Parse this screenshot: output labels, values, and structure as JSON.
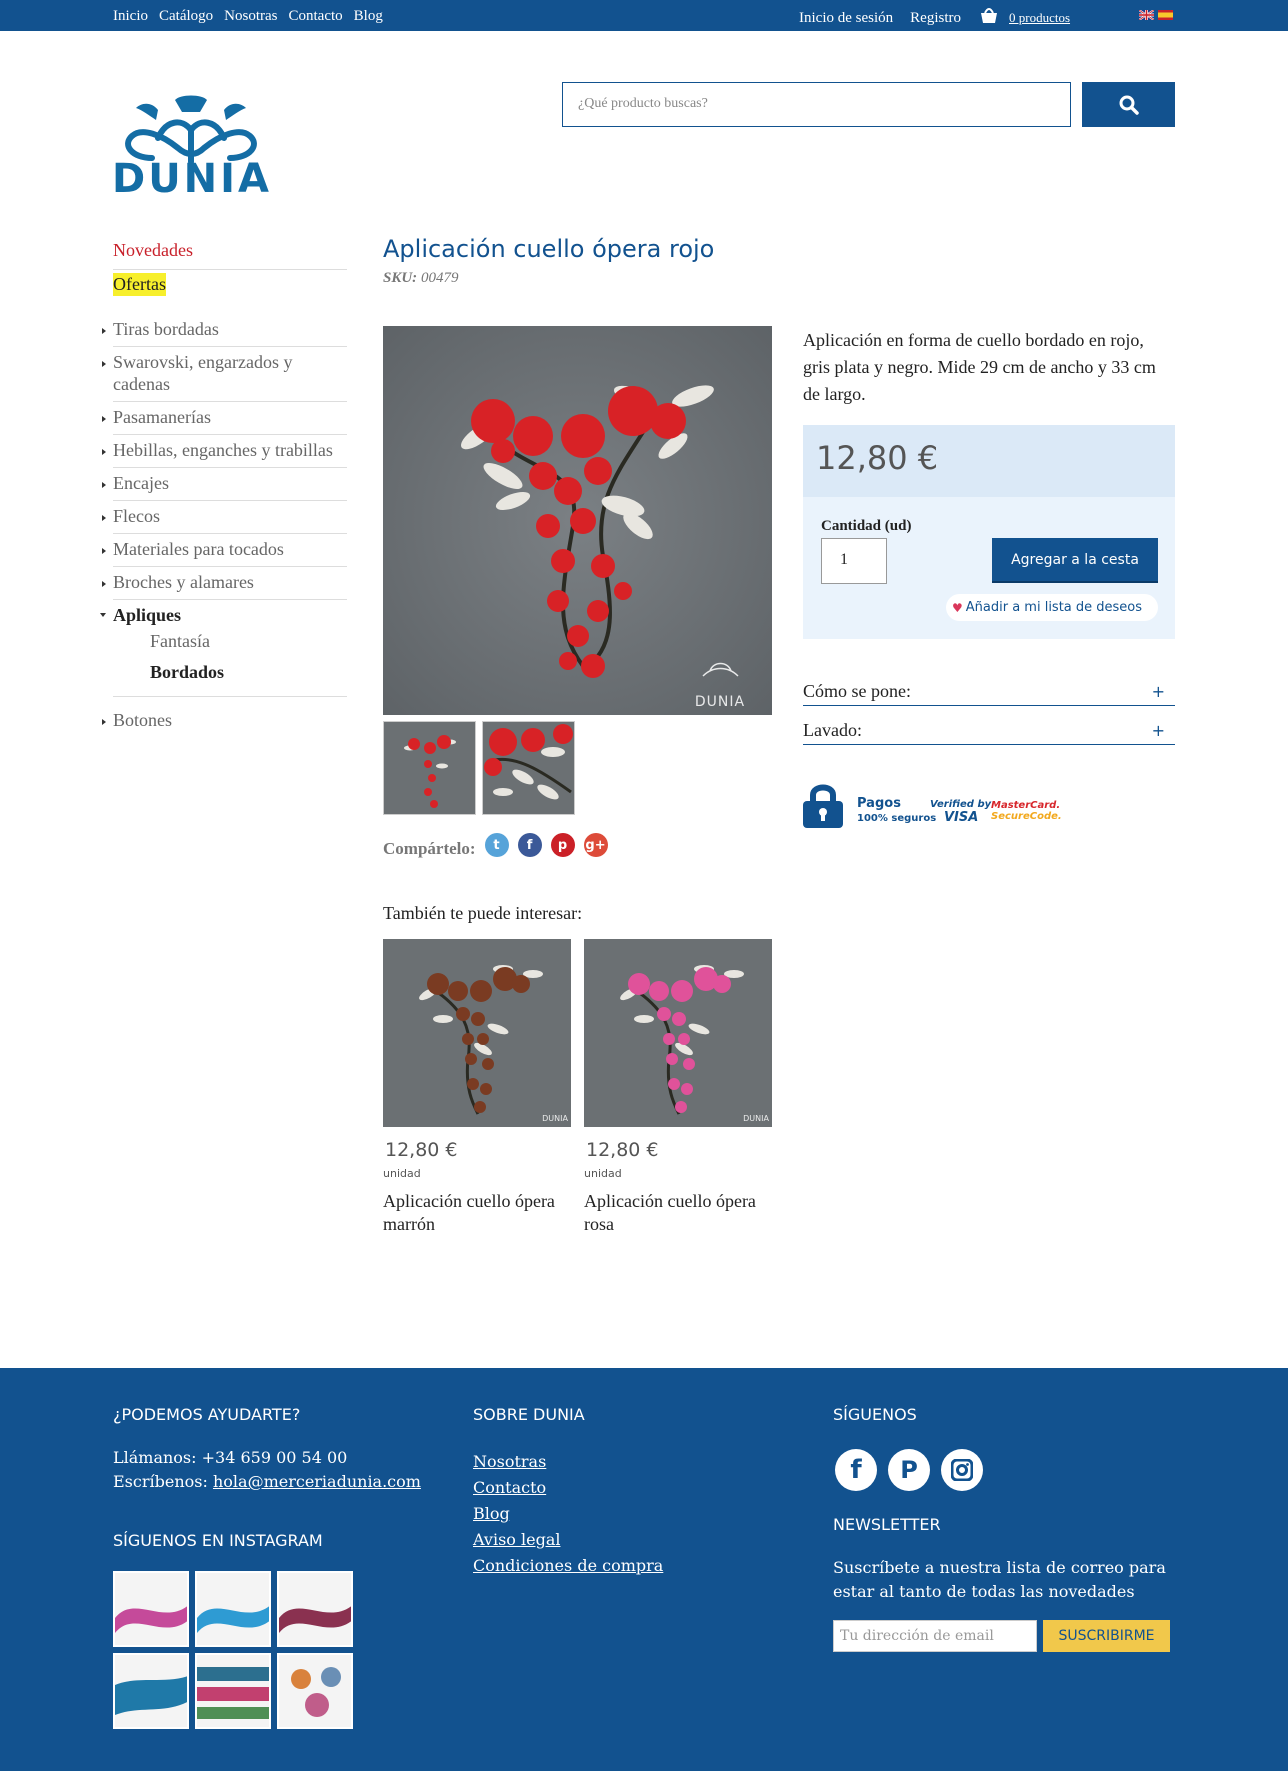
{
  "topbar": {
    "nav": [
      "Inicio",
      "Catálogo",
      "Nosotras",
      "Contacto",
      "Blog"
    ],
    "login": "Inicio de sesión",
    "register": "Registro",
    "cart": "0 productos",
    "basket_icon": "basket-icon",
    "flags": [
      "en-flag-icon",
      "es-flag-icon"
    ]
  },
  "brand": {
    "logo_text": "DUNIA"
  },
  "search": {
    "placeholder": "¿Qué producto buscas?",
    "icon": "search-icon"
  },
  "sidebar": {
    "highlight_new": "Novedades",
    "highlight_offers": "Ofertas",
    "categories": [
      "Tiras bordadas",
      "Swarovski, engarzados y cadenas",
      "Pasamanerías",
      "Hebillas, enganches y trabillas",
      "Encajes",
      "Flecos",
      "Materiales para tocados",
      "Broches y alamares"
    ],
    "open_category": "Apliques",
    "subcategories": [
      "Fantasía",
      "Bordados"
    ],
    "active_subcategory": "Bordados",
    "last_category": "Botones"
  },
  "product": {
    "title": "Aplicación cuello ópera rojo",
    "sku_label": "SKU:",
    "sku": "00479",
    "description": "Aplicación en forma de cuello bordado en rojo, gris plata y negro. Mide 29 cm de ancho y 33 cm de largo.",
    "price": "12,80 €",
    "quantity_label": "Cantidad (ud)",
    "quantity": "1",
    "add_to_cart": "Agregar a la cesta",
    "wishlist": "Añadir a mi lista de deseos",
    "share_label": "Compártelo:",
    "share_icons": [
      "twitter-icon",
      "facebook-icon",
      "pinterest-icon",
      "google-plus-icon"
    ],
    "accordions": [
      "Cómo se pone:",
      "Lavado:"
    ],
    "watermark": "DUNIA"
  },
  "payments": {
    "title": "Pagos",
    "subtitle": "100% seguros",
    "visa_top": "Verified by",
    "visa_bottom": "VISA",
    "mc_top": "MasterCard.",
    "mc_bottom": "SecureCode."
  },
  "related": {
    "title": "También te puede interesar:",
    "items": [
      {
        "price": "12,80 €",
        "unit": "unidad",
        "name": "Aplicación cuello ópera marrón",
        "color": "#7a3b22"
      },
      {
        "price": "12,80 €",
        "unit": "unidad",
        "name": "Aplicación cuello ópera rosa",
        "color": "#e0529a"
      }
    ]
  },
  "footer": {
    "help_title": "¿PODEMOS AYUDARTE?",
    "call_label": "Llámanos:",
    "phone": "+34 659 00 54 00",
    "write_label": "Escríbenos:",
    "email": "hola@merceriadunia.com",
    "instagram_title": "SÍGUENOS EN INSTAGRAM",
    "about_title": "SOBRE DUNIA",
    "about_links": [
      "Nosotras",
      "Contacto",
      "Blog",
      "Aviso legal",
      "Condiciones de compra"
    ],
    "follow_title": "SÍGUENOS",
    "social_icons": [
      "facebook-icon",
      "pinterest-icon",
      "instagram-icon"
    ],
    "newsletter_title": "NEWSLETTER",
    "newsletter_text": "Suscríbete a nuestra lista de correo para estar al tanto de todas las novedades",
    "email_placeholder": "Tu dirección de email",
    "subscribe": "SUSCRIBIRME"
  },
  "colors": {
    "brand_blue": "#12528f",
    "logo_blue": "#146da5",
    "offer_yellow": "#f7ef2c",
    "new_red": "#c8202a",
    "subscribe_yellow": "#f1c84b"
  }
}
